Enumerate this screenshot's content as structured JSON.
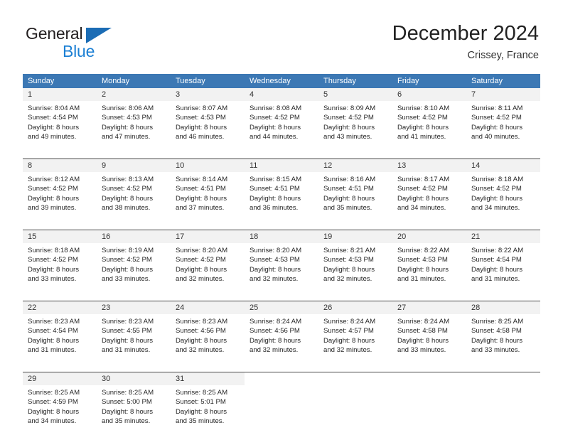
{
  "logo": {
    "primary_text": "General",
    "secondary_text": "Blue",
    "triangle_color": "#1b6cb5",
    "secondary_color": "#1b7fd4"
  },
  "header": {
    "title": "December 2024",
    "location": "Crissey, France"
  },
  "theme": {
    "header_row_bg": "#3c78b4",
    "header_row_text": "#ffffff",
    "day_number_bg": "#f2f2f2",
    "row_separator": "#4a4a4a"
  },
  "calendar": {
    "day_headers": [
      "Sunday",
      "Monday",
      "Tuesday",
      "Wednesday",
      "Thursday",
      "Friday",
      "Saturday"
    ],
    "weeks": [
      [
        {
          "day": "1",
          "sunrise": "Sunrise: 8:04 AM",
          "sunset": "Sunset: 4:54 PM",
          "daylight_line1": "Daylight: 8 hours",
          "daylight_line2": "and 49 minutes."
        },
        {
          "day": "2",
          "sunrise": "Sunrise: 8:06 AM",
          "sunset": "Sunset: 4:53 PM",
          "daylight_line1": "Daylight: 8 hours",
          "daylight_line2": "and 47 minutes."
        },
        {
          "day": "3",
          "sunrise": "Sunrise: 8:07 AM",
          "sunset": "Sunset: 4:53 PM",
          "daylight_line1": "Daylight: 8 hours",
          "daylight_line2": "and 46 minutes."
        },
        {
          "day": "4",
          "sunrise": "Sunrise: 8:08 AM",
          "sunset": "Sunset: 4:52 PM",
          "daylight_line1": "Daylight: 8 hours",
          "daylight_line2": "and 44 minutes."
        },
        {
          "day": "5",
          "sunrise": "Sunrise: 8:09 AM",
          "sunset": "Sunset: 4:52 PM",
          "daylight_line1": "Daylight: 8 hours",
          "daylight_line2": "and 43 minutes."
        },
        {
          "day": "6",
          "sunrise": "Sunrise: 8:10 AM",
          "sunset": "Sunset: 4:52 PM",
          "daylight_line1": "Daylight: 8 hours",
          "daylight_line2": "and 41 minutes."
        },
        {
          "day": "7",
          "sunrise": "Sunrise: 8:11 AM",
          "sunset": "Sunset: 4:52 PM",
          "daylight_line1": "Daylight: 8 hours",
          "daylight_line2": "and 40 minutes."
        }
      ],
      [
        {
          "day": "8",
          "sunrise": "Sunrise: 8:12 AM",
          "sunset": "Sunset: 4:52 PM",
          "daylight_line1": "Daylight: 8 hours",
          "daylight_line2": "and 39 minutes."
        },
        {
          "day": "9",
          "sunrise": "Sunrise: 8:13 AM",
          "sunset": "Sunset: 4:52 PM",
          "daylight_line1": "Daylight: 8 hours",
          "daylight_line2": "and 38 minutes."
        },
        {
          "day": "10",
          "sunrise": "Sunrise: 8:14 AM",
          "sunset": "Sunset: 4:51 PM",
          "daylight_line1": "Daylight: 8 hours",
          "daylight_line2": "and 37 minutes."
        },
        {
          "day": "11",
          "sunrise": "Sunrise: 8:15 AM",
          "sunset": "Sunset: 4:51 PM",
          "daylight_line1": "Daylight: 8 hours",
          "daylight_line2": "and 36 minutes."
        },
        {
          "day": "12",
          "sunrise": "Sunrise: 8:16 AM",
          "sunset": "Sunset: 4:51 PM",
          "daylight_line1": "Daylight: 8 hours",
          "daylight_line2": "and 35 minutes."
        },
        {
          "day": "13",
          "sunrise": "Sunrise: 8:17 AM",
          "sunset": "Sunset: 4:52 PM",
          "daylight_line1": "Daylight: 8 hours",
          "daylight_line2": "and 34 minutes."
        },
        {
          "day": "14",
          "sunrise": "Sunrise: 8:18 AM",
          "sunset": "Sunset: 4:52 PM",
          "daylight_line1": "Daylight: 8 hours",
          "daylight_line2": "and 34 minutes."
        }
      ],
      [
        {
          "day": "15",
          "sunrise": "Sunrise: 8:18 AM",
          "sunset": "Sunset: 4:52 PM",
          "daylight_line1": "Daylight: 8 hours",
          "daylight_line2": "and 33 minutes."
        },
        {
          "day": "16",
          "sunrise": "Sunrise: 8:19 AM",
          "sunset": "Sunset: 4:52 PM",
          "daylight_line1": "Daylight: 8 hours",
          "daylight_line2": "and 33 minutes."
        },
        {
          "day": "17",
          "sunrise": "Sunrise: 8:20 AM",
          "sunset": "Sunset: 4:52 PM",
          "daylight_line1": "Daylight: 8 hours",
          "daylight_line2": "and 32 minutes."
        },
        {
          "day": "18",
          "sunrise": "Sunrise: 8:20 AM",
          "sunset": "Sunset: 4:53 PM",
          "daylight_line1": "Daylight: 8 hours",
          "daylight_line2": "and 32 minutes."
        },
        {
          "day": "19",
          "sunrise": "Sunrise: 8:21 AM",
          "sunset": "Sunset: 4:53 PM",
          "daylight_line1": "Daylight: 8 hours",
          "daylight_line2": "and 32 minutes."
        },
        {
          "day": "20",
          "sunrise": "Sunrise: 8:22 AM",
          "sunset": "Sunset: 4:53 PM",
          "daylight_line1": "Daylight: 8 hours",
          "daylight_line2": "and 31 minutes."
        },
        {
          "day": "21",
          "sunrise": "Sunrise: 8:22 AM",
          "sunset": "Sunset: 4:54 PM",
          "daylight_line1": "Daylight: 8 hours",
          "daylight_line2": "and 31 minutes."
        }
      ],
      [
        {
          "day": "22",
          "sunrise": "Sunrise: 8:23 AM",
          "sunset": "Sunset: 4:54 PM",
          "daylight_line1": "Daylight: 8 hours",
          "daylight_line2": "and 31 minutes."
        },
        {
          "day": "23",
          "sunrise": "Sunrise: 8:23 AM",
          "sunset": "Sunset: 4:55 PM",
          "daylight_line1": "Daylight: 8 hours",
          "daylight_line2": "and 31 minutes."
        },
        {
          "day": "24",
          "sunrise": "Sunrise: 8:23 AM",
          "sunset": "Sunset: 4:56 PM",
          "daylight_line1": "Daylight: 8 hours",
          "daylight_line2": "and 32 minutes."
        },
        {
          "day": "25",
          "sunrise": "Sunrise: 8:24 AM",
          "sunset": "Sunset: 4:56 PM",
          "daylight_line1": "Daylight: 8 hours",
          "daylight_line2": "and 32 minutes."
        },
        {
          "day": "26",
          "sunrise": "Sunrise: 8:24 AM",
          "sunset": "Sunset: 4:57 PM",
          "daylight_line1": "Daylight: 8 hours",
          "daylight_line2": "and 32 minutes."
        },
        {
          "day": "27",
          "sunrise": "Sunrise: 8:24 AM",
          "sunset": "Sunset: 4:58 PM",
          "daylight_line1": "Daylight: 8 hours",
          "daylight_line2": "and 33 minutes."
        },
        {
          "day": "28",
          "sunrise": "Sunrise: 8:25 AM",
          "sunset": "Sunset: 4:58 PM",
          "daylight_line1": "Daylight: 8 hours",
          "daylight_line2": "and 33 minutes."
        }
      ],
      [
        {
          "day": "29",
          "sunrise": "Sunrise: 8:25 AM",
          "sunset": "Sunset: 4:59 PM",
          "daylight_line1": "Daylight: 8 hours",
          "daylight_line2": "and 34 minutes."
        },
        {
          "day": "30",
          "sunrise": "Sunrise: 8:25 AM",
          "sunset": "Sunset: 5:00 PM",
          "daylight_line1": "Daylight: 8 hours",
          "daylight_line2": "and 35 minutes."
        },
        {
          "day": "31",
          "sunrise": "Sunrise: 8:25 AM",
          "sunset": "Sunset: 5:01 PM",
          "daylight_line1": "Daylight: 8 hours",
          "daylight_line2": "and 35 minutes."
        },
        {
          "day": "",
          "sunrise": "",
          "sunset": "",
          "daylight_line1": "",
          "daylight_line2": ""
        },
        {
          "day": "",
          "sunrise": "",
          "sunset": "",
          "daylight_line1": "",
          "daylight_line2": ""
        },
        {
          "day": "",
          "sunrise": "",
          "sunset": "",
          "daylight_line1": "",
          "daylight_line2": ""
        },
        {
          "day": "",
          "sunrise": "",
          "sunset": "",
          "daylight_line1": "",
          "daylight_line2": ""
        }
      ]
    ]
  }
}
